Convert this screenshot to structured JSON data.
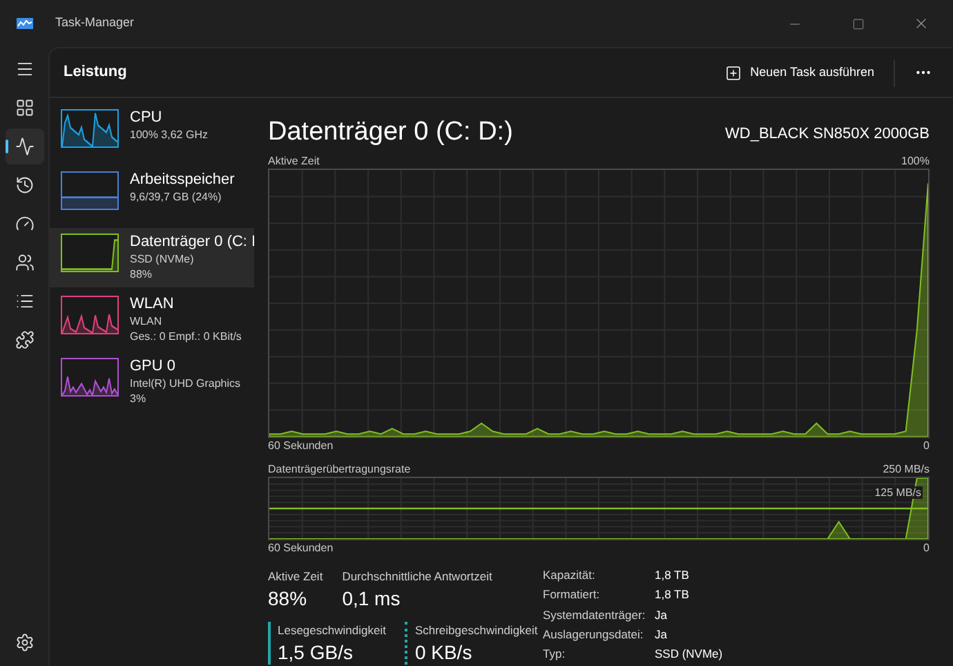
{
  "window": {
    "title": "Task-Manager"
  },
  "nav": [
    {
      "kind": "menu",
      "selected": false
    },
    {
      "kind": "processes",
      "selected": false
    },
    {
      "kind": "performance",
      "selected": true
    },
    {
      "kind": "history",
      "selected": false
    },
    {
      "kind": "startup",
      "selected": false
    },
    {
      "kind": "users",
      "selected": false
    },
    {
      "kind": "details",
      "selected": false
    },
    {
      "kind": "services",
      "selected": false
    },
    {
      "kind": "settings",
      "selected": false
    }
  ],
  "header": {
    "title": "Leistung",
    "run_task": "Neuen Task ausführen"
  },
  "devices": [
    {
      "name": "CPU",
      "lines": [
        "100% 3,62 GHz"
      ],
      "color": "#1ba1e2",
      "selected": false
    },
    {
      "name": "Arbeitsspeicher",
      "lines": [
        "9,6/39,7 GB (24%)"
      ],
      "color": "#4a7fd6",
      "selected": false
    },
    {
      "name": "Datenträger 0 (C: I",
      "lines": [
        "SSD (NVMe)",
        "88%"
      ],
      "color": "#7fbf1f",
      "selected": true
    },
    {
      "name": "WLAN",
      "lines": [
        "WLAN",
        "Ges.: 0 Empf.: 0 KBit/s"
      ],
      "color": "#e0407f",
      "selected": false
    },
    {
      "name": "GPU 0",
      "lines": [
        "Intel(R) UHD Graphics",
        "3%"
      ],
      "color": "#b04fd0",
      "selected": false
    }
  ],
  "detail": {
    "title": "Datenträger 0 (C: D:)",
    "model": "WD_BLACK SN850X 2000GB",
    "active_chart": {
      "label": "Aktive Zeit",
      "max_label": "100%",
      "time_start": "60 Sekunden",
      "time_end": "0"
    },
    "rate_chart": {
      "label": "Datenträgerübertragungsrate",
      "max_label": "250 MB/s",
      "mid_label": "125 MB/s",
      "time_start": "60 Sekunden",
      "time_end": "0"
    },
    "stats": [
      {
        "label": "Aktive Zeit",
        "value": "88%"
      },
      {
        "label": "Durchschnittliche Antwortzeit",
        "value": "0,1 ms"
      }
    ],
    "speeds": [
      {
        "label": "Lesegeschwindigkeit",
        "value": "1,5 GB/s",
        "kind": "solid"
      },
      {
        "label": "Schreibgeschwindigkeit",
        "value": "0 KB/s",
        "kind": "dashed"
      }
    ],
    "properties": [
      {
        "label": "Kapazität:",
        "value": "1,8 TB"
      },
      {
        "label": "Formatiert:",
        "value": "1,8 TB"
      },
      {
        "label": "Systemdatenträger:",
        "value": "Ja"
      },
      {
        "label": "Auslagerungsdatei:",
        "value": "Ja"
      },
      {
        "label": "Typ:",
        "value": "SSD (NVMe)"
      }
    ]
  }
}
